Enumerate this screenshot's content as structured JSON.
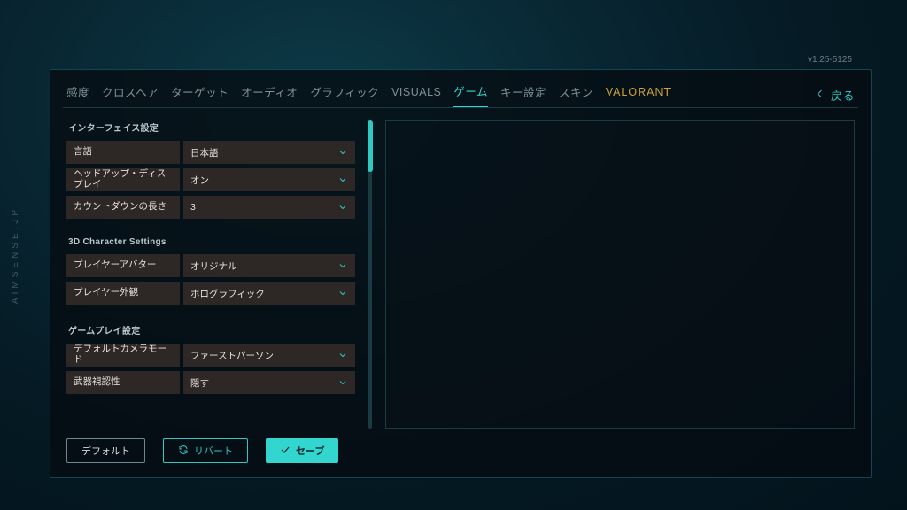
{
  "watermark": "AIMSENSE.JP",
  "version": "v1.25-5125",
  "back_label": "戻る",
  "tabs": [
    {
      "label": "感度"
    },
    {
      "label": "クロスヘア"
    },
    {
      "label": "ターゲット"
    },
    {
      "label": "オーディオ"
    },
    {
      "label": "グラフィック"
    },
    {
      "label": "VISUALS"
    },
    {
      "label": "ゲーム",
      "active": true
    },
    {
      "label": "キー設定"
    },
    {
      "label": "スキン"
    },
    {
      "label": "VALORANT",
      "valorant": true
    }
  ],
  "sections": {
    "interface": {
      "title": "インターフェイス設定",
      "rows": {
        "language": {
          "label": "言語",
          "value": "日本語"
        },
        "hud": {
          "label": "ヘッドアップ・ディスプレイ",
          "value": "オン"
        },
        "countdown": {
          "label": "カウントダウンの長さ",
          "value": "3"
        }
      }
    },
    "character": {
      "title": "3D Character Settings",
      "rows": {
        "avatar": {
          "label": "プレイヤーアバター",
          "value": "オリジナル"
        },
        "appear": {
          "label": "プレイヤー外観",
          "value": "ホログラフィック"
        }
      }
    },
    "gameplay": {
      "title": "ゲームプレイ設定",
      "rows": {
        "camera": {
          "label": "デフォルトカメラモード",
          "value": "ファーストパーソン"
        },
        "weapon": {
          "label": "武器視認性",
          "value": "隠す"
        }
      }
    }
  },
  "footer": {
    "default": "デフォルト",
    "revert": "リバート",
    "save": "セーブ"
  }
}
